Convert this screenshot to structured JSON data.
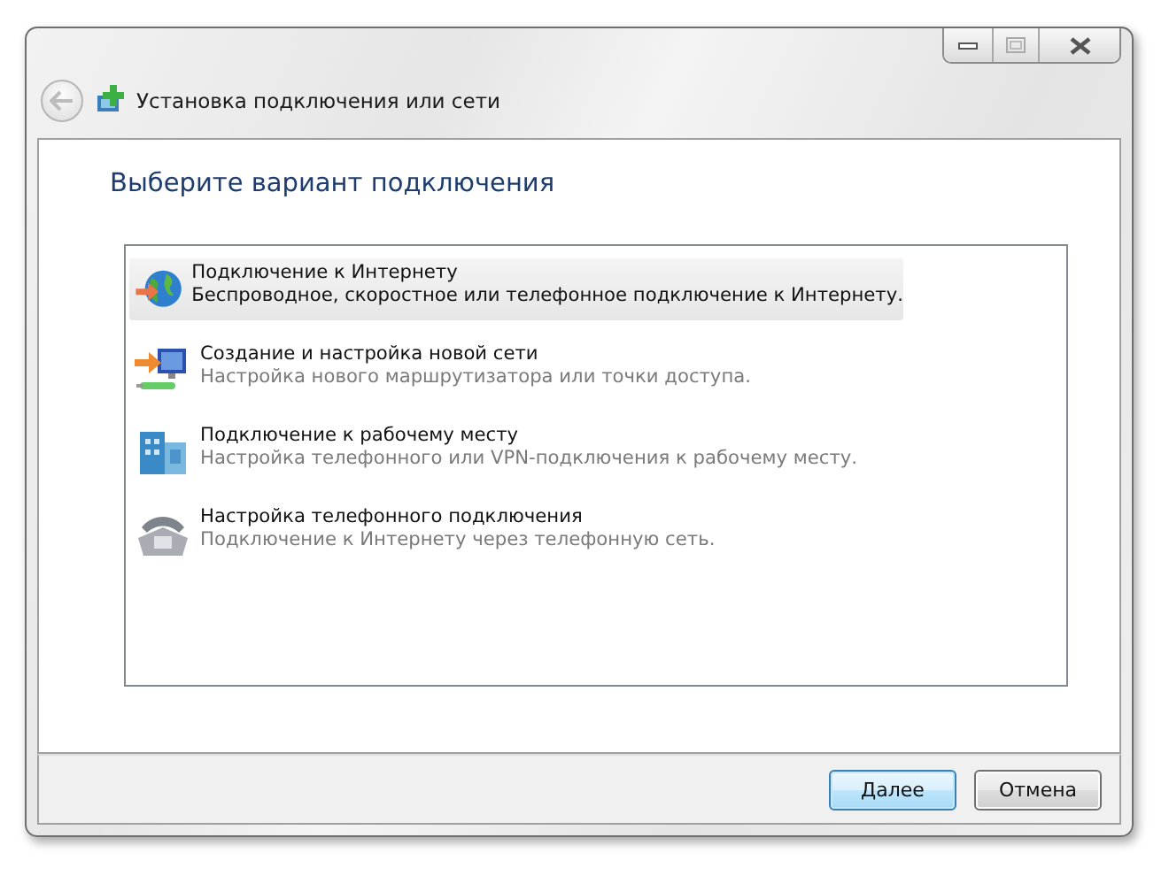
{
  "window": {
    "title": "Установка подключения или сети"
  },
  "heading": "Выберите вариант подключения",
  "options": [
    {
      "kind": "internet",
      "title": "Подключение к Интернету",
      "description": "Беспроводное, скоростное или телефонное подключение к Интернету.",
      "selected": true
    },
    {
      "kind": "network",
      "title": "Создание и настройка новой сети",
      "description": "Настройка нового маршрутизатора или точки доступа.",
      "selected": false
    },
    {
      "kind": "workplace",
      "title": "Подключение к рабочему месту",
      "description": "Настройка телефонного или VPN-подключения к рабочему месту.",
      "selected": false
    },
    {
      "kind": "dialup",
      "title": "Настройка телефонного подключения",
      "description": "Подключение к Интернету через телефонную сеть.",
      "selected": false
    }
  ],
  "buttons": [
    {
      "label": "Далее",
      "default": true
    },
    {
      "label": "Отмена",
      "default": false
    }
  ]
}
